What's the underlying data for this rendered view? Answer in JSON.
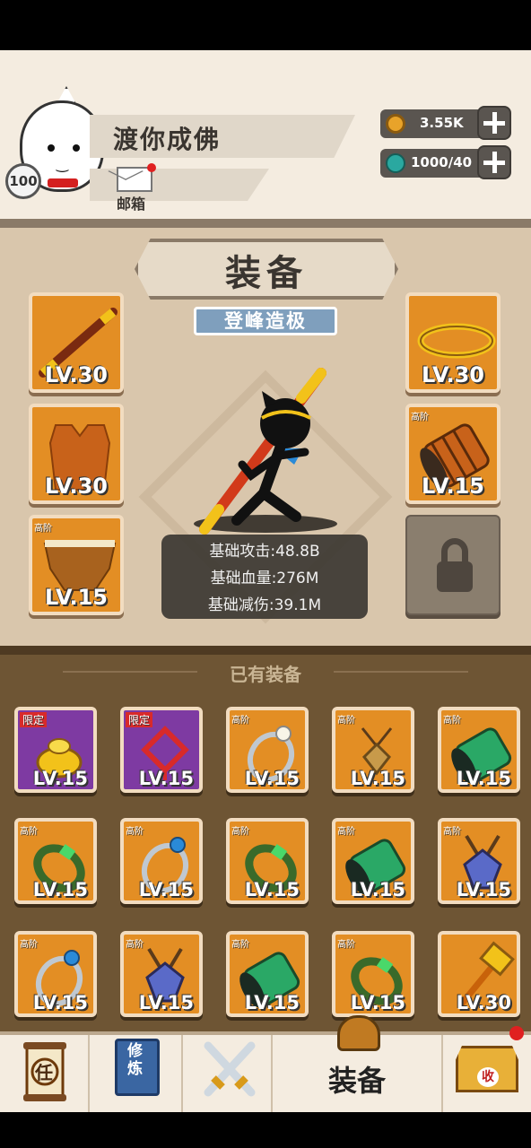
{
  "player": {
    "name": "渡你成佛",
    "level": "100",
    "mail_label": "邮箱"
  },
  "resources": {
    "coins": "3.55K",
    "energy": "1000/40"
  },
  "equipment_panel": {
    "title": "装备",
    "rank": "登峰造极",
    "slots": [
      {
        "name": "staff",
        "level": "LV.30",
        "tag": ""
      },
      {
        "name": "armor",
        "level": "LV.30",
        "tag": ""
      },
      {
        "name": "pants",
        "level": "LV.15",
        "tag": "高阶"
      },
      {
        "name": "headband",
        "level": "LV.30",
        "tag": ""
      },
      {
        "name": "bracer",
        "level": "LV.15",
        "tag": "高阶"
      }
    ],
    "stats": {
      "attack": "基础攻击:48.8B",
      "hp": "基础血量:276M",
      "reduction": "基础减伤:39.1M"
    }
  },
  "inventory": {
    "title": "已有装备",
    "items": [
      {
        "name": "gold-ingot",
        "level": "LV.15",
        "tag": "限定"
      },
      {
        "name": "chinese-knot",
        "level": "LV.15",
        "tag": "限定"
      },
      {
        "name": "pearl-ring",
        "level": "LV.15",
        "tag": "高阶"
      },
      {
        "name": "bronze-amulet",
        "level": "LV.15",
        "tag": "高阶"
      },
      {
        "name": "jade-bracer",
        "level": "LV.15",
        "tag": "高阶"
      },
      {
        "name": "jade-bangle",
        "level": "LV.15",
        "tag": "高阶"
      },
      {
        "name": "blue-gem-ring",
        "level": "LV.15",
        "tag": "高阶"
      },
      {
        "name": "jade-bangle",
        "level": "LV.15",
        "tag": "高阶"
      },
      {
        "name": "jade-bracer",
        "level": "LV.15",
        "tag": "高阶"
      },
      {
        "name": "blue-amulet",
        "level": "LV.15",
        "tag": "高阶"
      },
      {
        "name": "blue-gem-ring",
        "level": "LV.15",
        "tag": "高阶"
      },
      {
        "name": "blue-amulet",
        "level": "LV.15",
        "tag": "高阶"
      },
      {
        "name": "jade-bracer",
        "level": "LV.15",
        "tag": "高阶"
      },
      {
        "name": "jade-bangle",
        "level": "LV.15",
        "tag": "高阶"
      },
      {
        "name": "golden-hammer",
        "level": "LV.30",
        "tag": ""
      }
    ]
  },
  "nav": {
    "tasks": "任",
    "cultivate": "修炼",
    "equip": "装备",
    "collect": "收"
  },
  "colors": {
    "slot_orange": "#e38e24",
    "limited_purple": "#7e3aa2",
    "panel_beige": "#d9c6ac",
    "inventory_brown": "#6e5534"
  }
}
